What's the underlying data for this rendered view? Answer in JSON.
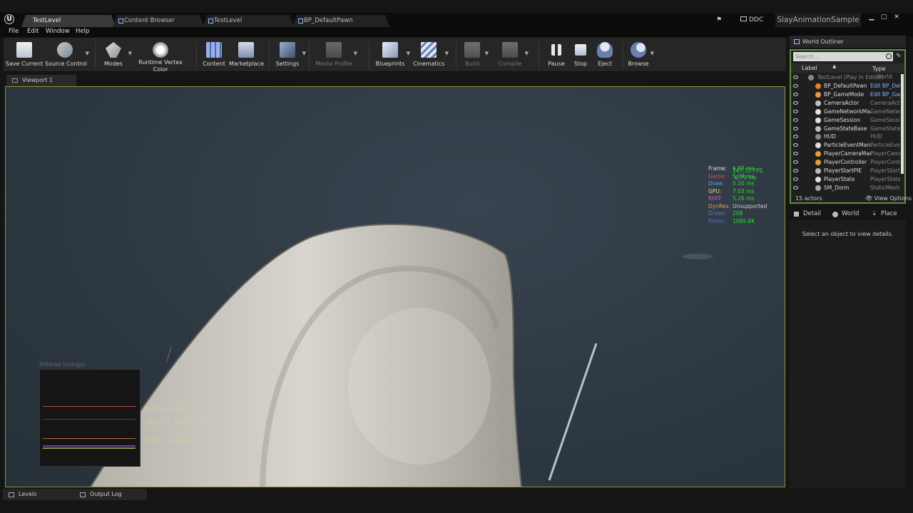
{
  "editor_tabs": [
    {
      "label": "TestLevel",
      "active": true
    },
    {
      "label": "Content Browser",
      "active": false
    },
    {
      "label": "TestLevel",
      "active": false
    },
    {
      "label": "BP_DefaultPawn",
      "active": false
    }
  ],
  "title_right": {
    "ddc": "DDC",
    "project": "SlayAnimationSample"
  },
  "window_controls": {
    "minimize": "▁",
    "maximize": "▢",
    "close": "✕"
  },
  "menu": [
    "File",
    "Edit",
    "Window",
    "Help"
  ],
  "toolbar": [
    {
      "label": "Save Current",
      "icon": "save-icon"
    },
    {
      "label": "Source Control",
      "icon": "source-control-icon"
    },
    {
      "label": "Modes",
      "icon": "modes-icon"
    },
    {
      "label": "Runtime Vertex Color\nPaint & Detection",
      "icon": "vertex-color-icon"
    },
    {
      "label": "Content",
      "icon": "content-icon"
    },
    {
      "label": "Marketplace",
      "icon": "marketplace-icon"
    },
    {
      "label": "Settings",
      "icon": "settings-icon"
    },
    {
      "label": "Media Profile",
      "icon": "media-profile-icon",
      "disabled": true
    },
    {
      "label": "Blueprints",
      "icon": "blueprints-icon"
    },
    {
      "label": "Cinematics",
      "icon": "cinematics-icon"
    },
    {
      "label": "Build",
      "icon": "build-icon",
      "disabled": true
    },
    {
      "label": "Compile",
      "icon": "compile-icon",
      "disabled": true
    },
    {
      "label": "Pause",
      "icon": "pause-icon"
    },
    {
      "label": "Stop",
      "icon": "stop-icon"
    },
    {
      "label": "Eject",
      "icon": "eject-icon"
    },
    {
      "label": "Browse",
      "icon": "browse-icon"
    }
  ],
  "viewport": {
    "tab": "Viewport 1",
    "stats": {
      "fps": "147.35 FPS",
      "ms": "6.79 ms",
      "rows": [
        {
          "key": "Frame:",
          "value": "6.88 ms",
          "color": "#e0e0e0"
        },
        {
          "key": "Game:",
          "value": "5.97 ms",
          "color": "#e05050"
        },
        {
          "key": "Draw:",
          "value": "5.20 ms",
          "color": "#5aa0ff"
        },
        {
          "key": "GPU:",
          "value": "7.03 ms",
          "color": "#e0e070"
        },
        {
          "key": "RHIT:",
          "value": "5.26 ms",
          "color": "#d060d0"
        },
        {
          "key": "DynRes:",
          "value": "Unsupported",
          "color": "#e0a060",
          "value_color": "#cfcfcf"
        },
        {
          "key": "Draws:",
          "value": "208",
          "color": "#5a70d0"
        },
        {
          "key": "Prims:",
          "value": "1085.6K",
          "color": "#5a70d0"
        }
      ]
    },
    "timings": {
      "title": "(Filtered timings)",
      "labels": [
        "33.9 ms (budget)",
        "-100.0% x -100.0% (max)",
        "70.0% x 70.0% (alert)"
      ]
    }
  },
  "bottom_tabs": [
    "Levels",
    "Output Log"
  ],
  "outliner": {
    "title": "World Outliner",
    "search_placeholder": "Search...",
    "col_label": "Label",
    "col_type": "Type",
    "root": "TestLevel (Play In Editor)",
    "root_type": "World",
    "rows": [
      {
        "name": "BP_DefaultPawn",
        "type": "Edit BP_DefaultPawn",
        "link": true
      },
      {
        "name": "BP_GameMode",
        "type": "Edit BP_GameMode",
        "link": true
      },
      {
        "name": "CameraActor",
        "type": "CameraActor"
      },
      {
        "name": "GameNetworkManager",
        "type": "GameNetworkManager"
      },
      {
        "name": "GameSession",
        "type": "GameSession"
      },
      {
        "name": "GameStateBase",
        "type": "GameStateBase"
      },
      {
        "name": "HUD",
        "type": "HUD"
      },
      {
        "name": "ParticleEventManager",
        "type": "ParticleEventManager"
      },
      {
        "name": "PlayerCameraManager",
        "type": "PlayerCameraManager"
      },
      {
        "name": "PlayerController",
        "type": "PlayerController"
      },
      {
        "name": "PlayerStartPIE",
        "type": "PlayerStart"
      },
      {
        "name": "PlayerState",
        "type": "PlayerState"
      },
      {
        "name": "SM_Dorm",
        "type": "StaticMesh"
      }
    ],
    "actor_count": "15 actors",
    "view_options": "View Options"
  },
  "detail_tabs": [
    "Detail",
    "World",
    "Place"
  ],
  "details_message": "Select an object to view details."
}
